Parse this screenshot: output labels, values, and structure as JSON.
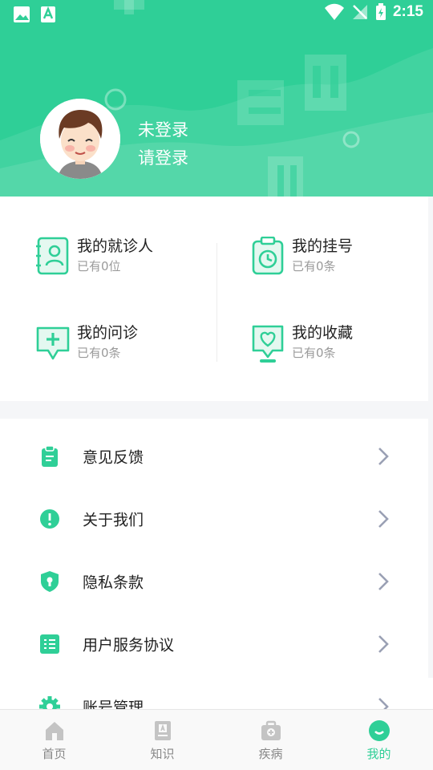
{
  "status_bar": {
    "time": "2:15"
  },
  "profile": {
    "name": "未登录",
    "prompt": "请登录"
  },
  "quick_grid": [
    {
      "title": "我的就诊人",
      "subtitle": "已有0位"
    },
    {
      "title": "我的挂号",
      "subtitle": "已有0条"
    },
    {
      "title": "我的问诊",
      "subtitle": "已有0条"
    },
    {
      "title": "我的收藏",
      "subtitle": "已有0条"
    }
  ],
  "menu": [
    {
      "label": "意见反馈"
    },
    {
      "label": "关于我们"
    },
    {
      "label": "隐私条款"
    },
    {
      "label": "用户服务协议"
    },
    {
      "label": "账号管理"
    }
  ],
  "bottom_nav": [
    {
      "label": "首页"
    },
    {
      "label": "知识"
    },
    {
      "label": "疾病"
    },
    {
      "label": "我的"
    }
  ],
  "colors": {
    "accent": "#2fcf97",
    "icon_gray": "#c4c4c4",
    "chevron": "#9aa0b4"
  }
}
